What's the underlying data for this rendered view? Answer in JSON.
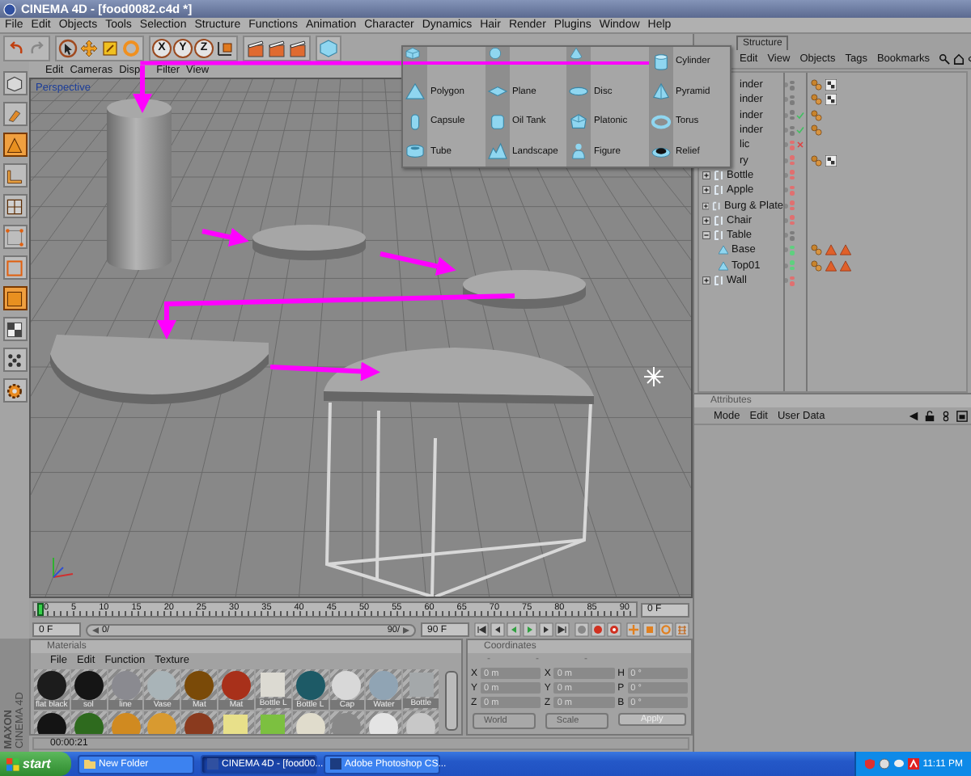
{
  "window": {
    "title": "CINEMA 4D - [food0082.c4d *]"
  },
  "menu": [
    "File",
    "Edit",
    "Objects",
    "Tools",
    "Selection",
    "Structure",
    "Functions",
    "Animation",
    "Character",
    "Dynamics",
    "Hair",
    "Render",
    "Plugins",
    "Window",
    "Help"
  ],
  "toolbar": {
    "axis_buttons": [
      "X",
      "Y",
      "Z"
    ]
  },
  "left_tools": [
    {
      "active": false
    },
    {
      "active": false
    },
    {
      "active": true
    },
    {
      "active": false
    },
    {
      "active": false
    },
    {
      "active": false
    },
    {
      "active": false
    },
    {
      "active": true
    },
    {
      "active": false
    },
    {
      "active": false
    },
    {
      "active": false
    }
  ],
  "viewport": {
    "menu": [
      "Edit",
      "Cameras",
      "Disp",
      "Filter",
      "View"
    ],
    "camera": "Perspective"
  },
  "object_popup": {
    "items": [
      {
        "kind": "unlabeled"
      },
      {
        "kind": "unlabeled"
      },
      {
        "kind": "unlabeled"
      },
      {
        "kind": "labeled",
        "label": "Cylinder"
      },
      {
        "kind": "labeled",
        "label": "Polygon"
      },
      {
        "kind": "labeled",
        "label": "Plane"
      },
      {
        "kind": "labeled",
        "label": "Disc"
      },
      {
        "kind": "labeled",
        "label": "Pyramid"
      },
      {
        "kind": "labeled",
        "label": "Capsule"
      },
      {
        "kind": "labeled",
        "label": "Oil Tank"
      },
      {
        "kind": "labeled",
        "label": "Platonic"
      },
      {
        "kind": "labeled",
        "label": "Torus"
      },
      {
        "kind": "labeled",
        "label": "Tube"
      },
      {
        "kind": "labeled",
        "label": "Landscape"
      },
      {
        "kind": "labeled",
        "label": "Figure"
      },
      {
        "kind": "labeled",
        "label": "Relief"
      }
    ]
  },
  "object_manager": {
    "tab": "Structure",
    "menu": [
      "Edit",
      "View",
      "Objects",
      "Tags",
      "Bookmarks"
    ],
    "objects": [
      {
        "name": "inder",
        "kind": "partial",
        "color": "#7c7c7c",
        "tags": [
          {
            "kind": "material"
          },
          {
            "kind": "checker"
          }
        ]
      },
      {
        "name": "inder",
        "kind": "partial",
        "color": "#7c7c7c",
        "tags": [
          {
            "kind": "material"
          },
          {
            "kind": "checker"
          }
        ]
      },
      {
        "name": "inder",
        "kind": "partial",
        "color": "#7c7c7c",
        "flag": {
          "kind": "check"
        },
        "tags": [
          {
            "kind": "material"
          }
        ]
      },
      {
        "name": "inder",
        "kind": "partial",
        "color": "#7c7c7c",
        "flag": {
          "kind": "check"
        },
        "tags": [
          {
            "kind": "material"
          }
        ]
      },
      {
        "name": "lic",
        "kind": "partial",
        "color": "#e07070",
        "flag": {
          "kind": "cross"
        }
      },
      {
        "name": "ry",
        "kind": "partial",
        "color": "#e07070",
        "tags": [
          {
            "kind": "material"
          },
          {
            "kind": "checker"
          }
        ]
      },
      {
        "name": "Bottle",
        "kind": "group",
        "expanded": false,
        "color": "#e07070"
      },
      {
        "name": "Apple",
        "kind": "group",
        "expanded": false,
        "color": "#e07070"
      },
      {
        "name": "Burg & Plate",
        "kind": "group",
        "expanded": false,
        "color": "#e07070"
      },
      {
        "name": "Chair",
        "kind": "group",
        "expanded": false,
        "color": "#e07070"
      },
      {
        "name": "Table",
        "kind": "group",
        "expanded": true,
        "color": "#7c7c7c",
        "children": [
          {
            "name": "Base",
            "kind": "mesh",
            "color": "#5fd07f",
            "tags": [
              {
                "kind": "material"
              },
              {
                "kind": "triangle"
              },
              {
                "kind": "triangle"
              }
            ]
          },
          {
            "name": "Top01",
            "kind": "mesh",
            "color": "#5fd07f",
            "tags": [
              {
                "kind": "material"
              },
              {
                "kind": "triangle"
              },
              {
                "kind": "triangle"
              }
            ]
          }
        ]
      },
      {
        "name": "Wall",
        "kind": "group",
        "expanded": false,
        "color": "#e07070"
      }
    ]
  },
  "attributes": {
    "title": "Attributes",
    "menu": [
      "Mode",
      "Edit",
      "User Data"
    ]
  },
  "timeline": {
    "ticks": [
      "0",
      "5",
      "10",
      "15",
      "20",
      "25",
      "30",
      "35",
      "40",
      "45",
      "50",
      "55",
      "60",
      "65",
      "70",
      "75",
      "80",
      "85",
      "90"
    ],
    "current": "0 F",
    "level": 0
  },
  "transport": {
    "start": "0 F",
    "range_start": "0/",
    "range_end": "90/",
    "end": "90 F"
  },
  "materials": {
    "title": "Materials",
    "menu": [
      "File",
      "Edit",
      "Function",
      "Texture"
    ],
    "items": [
      {
        "label": "flat black",
        "color": "#1c1c1c",
        "kind": "sphere"
      },
      {
        "label": "sol",
        "color": "#151515",
        "kind": "sphere"
      },
      {
        "label": "line",
        "color": "#8a8a90",
        "kind": "sphere"
      },
      {
        "label": "Vase",
        "color": "#a9b4b8",
        "kind": "sphere"
      },
      {
        "label": "Mat",
        "color": "#7a4a08",
        "kind": "sphere"
      },
      {
        "label": "Mat",
        "color": "#a8301a",
        "kind": "sphere"
      },
      {
        "label": "Bottle L",
        "color": "#dcdad2",
        "kind": "flat"
      },
      {
        "label": "Bottle L",
        "color": "#1d5a66",
        "kind": "sphere"
      },
      {
        "label": "Cap",
        "color": "#d8d8d8",
        "kind": "sphere"
      },
      {
        "label": "Water",
        "color": "#90a4b4",
        "kind": "sphere"
      },
      {
        "label": "Bottle",
        "color": "#a4a8aa",
        "kind": "flat"
      },
      {
        "color": "#141414",
        "kind": "sphere"
      },
      {
        "color": "#2e6a1e",
        "kind": "sphere"
      },
      {
        "color": "#d08a20",
        "kind": "sphere"
      },
      {
        "color": "#d89a30",
        "kind": "sphere"
      },
      {
        "color": "#8a3a1e",
        "kind": "sphere"
      },
      {
        "color": "#e8e08a",
        "kind": "flat"
      },
      {
        "color": "#7cc040",
        "kind": "flat"
      },
      {
        "color": "#e0dccc",
        "kind": "sphere"
      },
      {
        "color": "#888888",
        "kind": "sphere"
      },
      {
        "color": "#e4e4e4",
        "kind": "sphere"
      },
      {
        "color": "#c8c8c8",
        "kind": "sphere"
      }
    ]
  },
  "coordinates": {
    "title": "Coordinates",
    "headers": [
      "-",
      "-",
      "-"
    ],
    "rows": [
      {
        "fields": [
          {
            "axis": "X",
            "value": "0 m"
          },
          {
            "axis": "X",
            "value": "0 m"
          },
          {
            "axis": "H",
            "value": "0 °"
          }
        ]
      },
      {
        "fields": [
          {
            "axis": "Y",
            "value": "0 m"
          },
          {
            "axis": "Y",
            "value": "0 m"
          },
          {
            "axis": "P",
            "value": "0 °"
          }
        ]
      },
      {
        "fields": [
          {
            "axis": "Z",
            "value": "0 m"
          },
          {
            "axis": "Z",
            "value": "0 m"
          },
          {
            "axis": "B",
            "value": "0 °"
          }
        ]
      }
    ],
    "mode": "World",
    "type": "Scale",
    "apply": "Apply"
  },
  "status": {
    "time": "00:00:21"
  },
  "logo": [
    "MAXON",
    "CINEMA 4D"
  ],
  "taskbar": {
    "start": "start",
    "tasks": [
      {
        "label": "New Folder",
        "selected": false
      },
      {
        "label": "CINEMA 4D - [food00...",
        "selected": true
      },
      {
        "label": "Adobe Photoshop CS...",
        "selected": false
      }
    ],
    "clock": "11:11 PM"
  }
}
